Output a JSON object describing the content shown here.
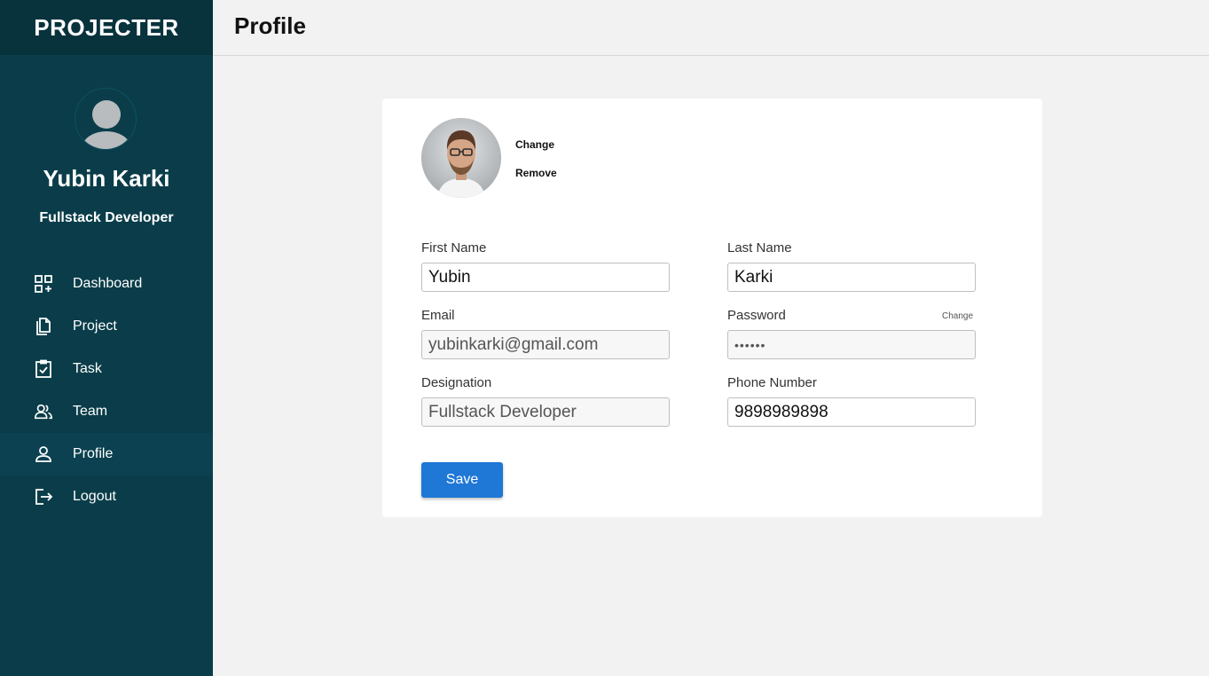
{
  "app": {
    "brand": "PROJECTER"
  },
  "header": {
    "title": "Profile"
  },
  "user": {
    "name": "Yubin Karki",
    "role": "Fullstack Developer"
  },
  "sidebar": {
    "items": [
      {
        "label": "Dashboard",
        "icon": "dashboard-icon"
      },
      {
        "label": "Project",
        "icon": "documents-icon"
      },
      {
        "label": "Task",
        "icon": "clipboard-check-icon"
      },
      {
        "label": "Team",
        "icon": "team-icon"
      },
      {
        "label": "Profile",
        "icon": "user-icon",
        "active": true
      },
      {
        "label": "Logout",
        "icon": "logout-icon"
      }
    ]
  },
  "profile": {
    "photo_change": "Change",
    "photo_remove": "Remove",
    "first_name": {
      "label": "First Name",
      "value": "Yubin"
    },
    "last_name": {
      "label": "Last Name",
      "value": "Karki"
    },
    "email": {
      "label": "Email",
      "value": "yubinkarki@gmail.com"
    },
    "password": {
      "label": "Password",
      "value": "••••••",
      "change": "Change"
    },
    "designation": {
      "label": "Designation",
      "value": "Fullstack Developer"
    },
    "phone": {
      "label": "Phone Number",
      "value": "9898989898"
    },
    "save_label": "Save"
  },
  "colors": {
    "sidebar": "#0a3d49",
    "brand_bar": "#08323c",
    "accent": "#1f77d6",
    "background": "#f2f2f2"
  }
}
